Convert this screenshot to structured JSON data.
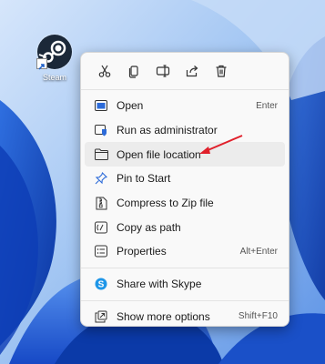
{
  "desktop": {
    "icon_label": "Steam"
  },
  "context_menu": {
    "toolbar": [
      "cut-icon",
      "copy-icon",
      "rename-icon",
      "share-icon",
      "delete-icon"
    ],
    "items": [
      {
        "label": "Open",
        "shortcut": "Enter",
        "icon": "open-app-icon"
      },
      {
        "label": "Run as administrator",
        "shortcut": "",
        "icon": "admin-shield-icon"
      },
      {
        "label": "Open file location",
        "shortcut": "",
        "icon": "folder-icon"
      },
      {
        "label": "Pin to Start",
        "shortcut": "",
        "icon": "pin-icon"
      },
      {
        "label": "Compress to Zip file",
        "shortcut": "",
        "icon": "zip-icon"
      },
      {
        "label": "Copy as path",
        "shortcut": "",
        "icon": "copy-path-icon"
      },
      {
        "label": "Properties",
        "shortcut": "Alt+Enter",
        "icon": "properties-icon"
      },
      {
        "label": "Share with Skype",
        "shortcut": "",
        "icon": "skype-icon"
      },
      {
        "label": "Show more options",
        "shortcut": "Shift+F10",
        "icon": "more-options-icon"
      }
    ]
  },
  "colors": {
    "accent": "#0067c0",
    "annotation_arrow": "#e0202b",
    "wallpaper_light": "#b9d5f5",
    "wallpaper_dark": "#0a3fb0"
  }
}
